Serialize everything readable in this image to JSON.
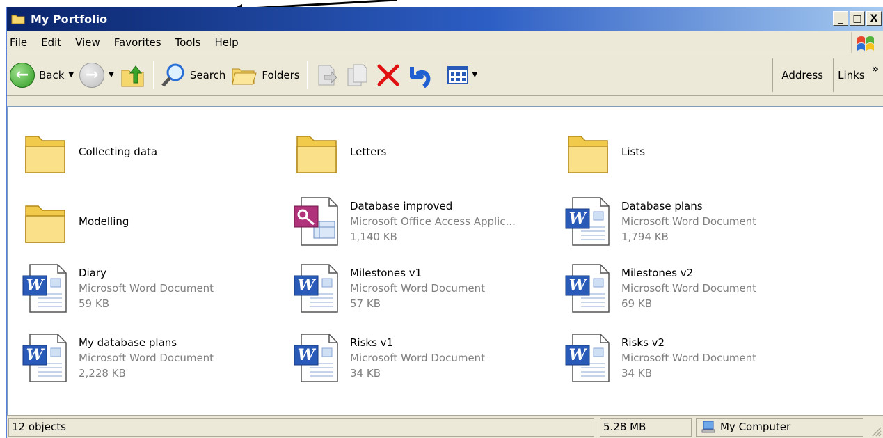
{
  "window": {
    "title": "My Portfolio",
    "controls": {
      "minimize": "_",
      "restore": "□",
      "close": "X"
    }
  },
  "menu": [
    "File",
    "Edit",
    "View",
    "Favorites",
    "Tools",
    "Help"
  ],
  "toolbar": {
    "back": "Back",
    "search": "Search",
    "folders": "Folders",
    "address": "Address",
    "links": "Links",
    "more": "»"
  },
  "items": [
    {
      "name": "Collecting data",
      "type": "folder"
    },
    {
      "name": "Letters",
      "type": "folder"
    },
    {
      "name": "Lists",
      "type": "folder"
    },
    {
      "name": "Modelling",
      "type": "folder"
    },
    {
      "name": "Database improved",
      "type": "access",
      "kind": "Microsoft Office Access Applic...",
      "size": "1,140 KB"
    },
    {
      "name": "Database plans",
      "type": "word",
      "kind": "Microsoft Word Document",
      "size": "1,794 KB"
    },
    {
      "name": "Diary",
      "type": "word",
      "kind": "Microsoft Word Document",
      "size": "59 KB"
    },
    {
      "name": "Milestones v1",
      "type": "word",
      "kind": "Microsoft Word Document",
      "size": "57 KB"
    },
    {
      "name": "Milestones v2",
      "type": "word",
      "kind": "Microsoft Word Document",
      "size": "69 KB"
    },
    {
      "name": "My database plans",
      "type": "word",
      "kind": "Microsoft Word Document",
      "size": "2,228 KB"
    },
    {
      "name": "Risks v1",
      "type": "word",
      "kind": "Microsoft Word Document",
      "size": "34 KB"
    },
    {
      "name": "Risks v2",
      "type": "word",
      "kind": "Microsoft Word Document",
      "size": "34 KB"
    }
  ],
  "status": {
    "objects": "12 objects",
    "size": "5.28 MB",
    "location": "My Computer"
  },
  "colors": {
    "title_start": "#0a246a",
    "title_end": "#a6caf0",
    "chrome": "#ece9d8",
    "folder": "#f5d76e",
    "word_blue": "#1f4fb8",
    "access_maroon": "#a3307a",
    "delete_red": "#e01010"
  }
}
